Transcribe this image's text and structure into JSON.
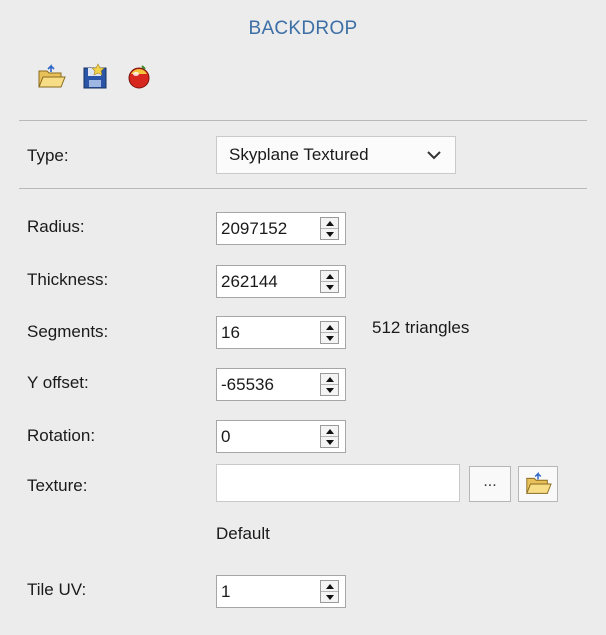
{
  "panel": {
    "title": "BACKDROP",
    "toolbar": [
      {
        "icon": "folder-open-icon",
        "kind": "open"
      },
      {
        "icon": "save-disk-icon",
        "kind": "save"
      },
      {
        "icon": "color-ball-icon",
        "kind": "material"
      }
    ]
  },
  "type": {
    "label": "Type:",
    "selected": "Skyplane Textured"
  },
  "fields": {
    "radius": {
      "label": "Radius:",
      "value": "2097152"
    },
    "thickness": {
      "label": "Thickness:",
      "value": "262144"
    },
    "segments": {
      "label": "Segments:",
      "value": "16",
      "note": "512 triangles"
    },
    "y_offset": {
      "label": "Y offset:",
      "value": "-65536"
    },
    "rotation": {
      "label": "Rotation:",
      "value": "0"
    },
    "texture": {
      "label": "Texture:",
      "value": "",
      "browse_label": "...",
      "status": "Default"
    },
    "tile_uv": {
      "label": "Tile UV:",
      "value": "1"
    }
  }
}
